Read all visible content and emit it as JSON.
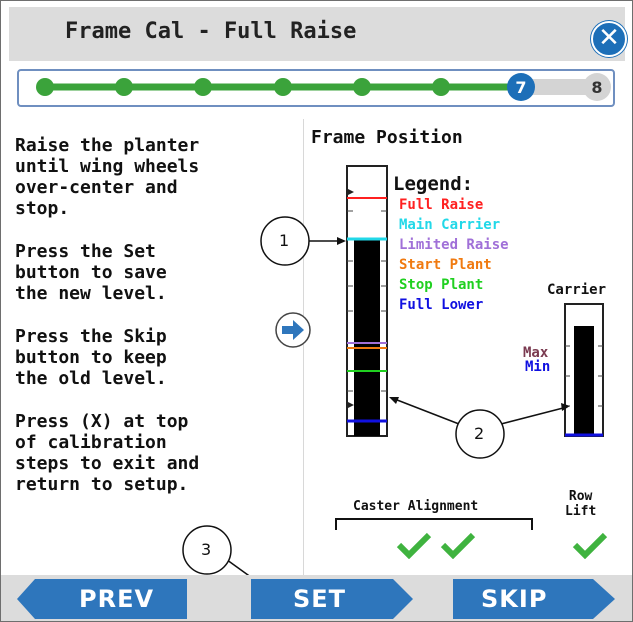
{
  "window": {
    "title": "Frame Cal - Full Raise",
    "close_glyph": "✕"
  },
  "progress": {
    "total_steps": 8,
    "current_step": "7",
    "last_step": "8",
    "done_color": "#3ba33b",
    "current_color": "#1d6fb8"
  },
  "instructions": [
    "Raise the planter\nuntil wing wheels\nover-center and\nstop.",
    "Press the Set\nbutton to save\nthe new level.",
    "Press the Skip\nbutton to keep\nthe old level.",
    "Press (X) at top\nof calibration\nsteps to exit and\nreturn to setup."
  ],
  "frame_position": {
    "heading": "Frame Position",
    "legend_title": "Legend:",
    "legend": [
      {
        "label": "Full Raise",
        "color": "#ff2020"
      },
      {
        "label": "Main Carrier",
        "color": "#22d8e8"
      },
      {
        "label": "Limited Raise",
        "color": "#a070d8"
      },
      {
        "label": "Start Plant",
        "color": "#f07a10"
      },
      {
        "label": "Stop Plant",
        "color": "#20d020"
      },
      {
        "label": "Full Lower",
        "color": "#1010e0"
      }
    ],
    "carrier_title": "Carrier",
    "carrier_max": "Max",
    "carrier_min": "Min",
    "carrier_max_color": "#7a3a50",
    "carrier_min_color": "#1010e0"
  },
  "callouts": [
    "1",
    "2",
    "3"
  ],
  "status": {
    "caster_alignment": "Caster Alignment",
    "row_lift_line1": "Row",
    "row_lift_line2": "Lift",
    "check_color": "#3fb33f"
  },
  "nav": {
    "prev": "PREV",
    "set": "SET",
    "skip": "SKIP",
    "button_color": "#2e76bc"
  },
  "icons": {
    "close": "close-icon",
    "arrow": "arrow-right-icon",
    "check": "check-icon"
  }
}
